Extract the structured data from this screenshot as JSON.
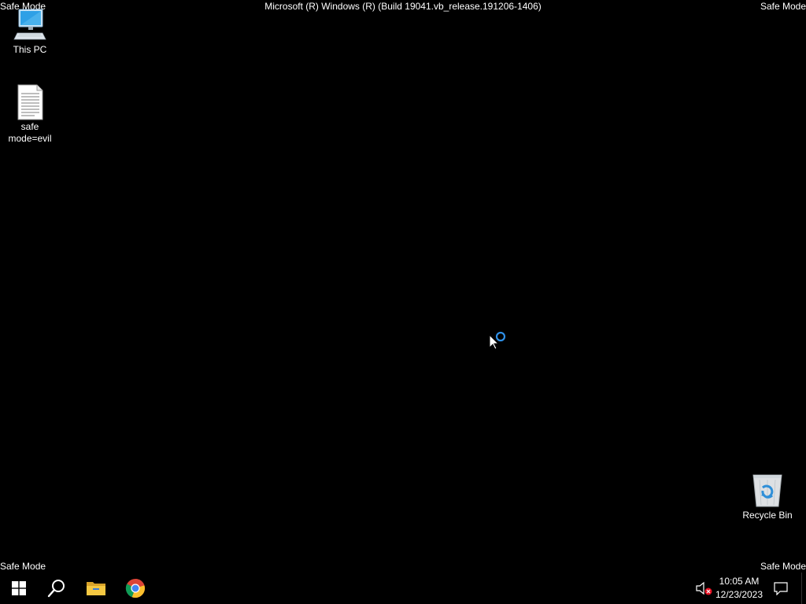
{
  "overlay": {
    "top_left": "Safe Mode",
    "top_center": "Microsoft (R) Windows (R) (Build 19041.vb_release.191206-1406)",
    "top_right": "Safe Mode",
    "bottom_left": "Safe Mode",
    "bottom_right": "Safe Mode"
  },
  "desktop_icons": [
    {
      "label": "This PC",
      "icon": "this-pc-icon"
    },
    {
      "label": "safe mode=evil",
      "icon": "text-file-icon"
    },
    {
      "label": "Recycle Bin",
      "icon": "recycle-bin-icon"
    }
  ],
  "taskbar": {
    "start": {
      "icon": "windows-logo-icon"
    },
    "search": {
      "icon": "search-icon"
    },
    "pinned": [
      {
        "name": "File Explorer",
        "icon": "folder-icon"
      },
      {
        "name": "Google Chrome",
        "icon": "chrome-icon"
      }
    ],
    "tray": {
      "volume_icon": "volume-muted-icon",
      "time": "10:05 AM",
      "date": "12/23/2023",
      "notification_icon": "action-center-icon"
    }
  },
  "colors": {
    "background": "#000000",
    "accent": "#1e90ff"
  }
}
